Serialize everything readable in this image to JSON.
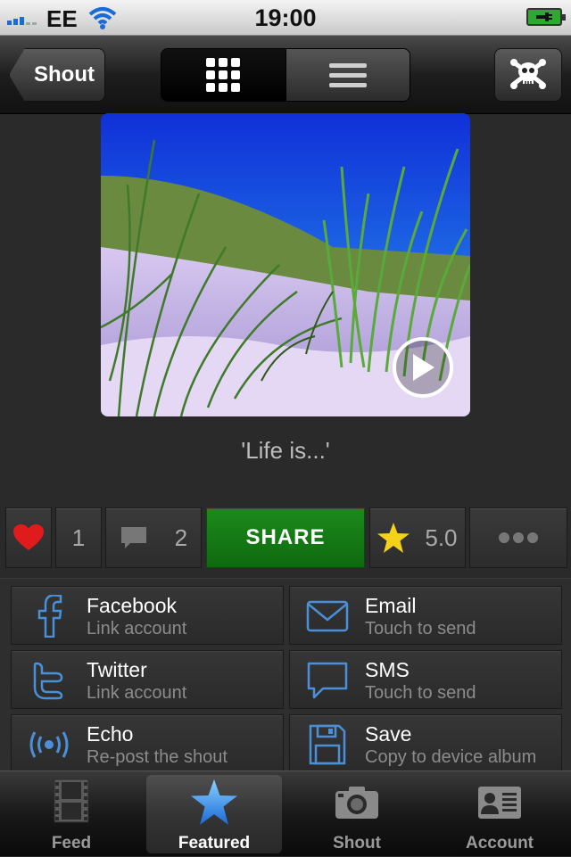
{
  "status": {
    "carrier": "EE",
    "time": "19:00"
  },
  "nav": {
    "back_label": "Shout",
    "segments": [
      "grid-view",
      "list-view"
    ],
    "active_segment": "grid-view"
  },
  "post": {
    "caption": "'Life is...'"
  },
  "actions": {
    "like_count": "1",
    "comment_count": "2",
    "share_label": "SHARE",
    "rating": "5.0"
  },
  "share_options": [
    {
      "title": "Facebook",
      "subtitle": "Link account",
      "icon": "facebook-icon"
    },
    {
      "title": "Email",
      "subtitle": "Touch to send",
      "icon": "envelope-icon"
    },
    {
      "title": "Twitter",
      "subtitle": "Link account",
      "icon": "twitter-icon"
    },
    {
      "title": "SMS",
      "subtitle": "Touch to send",
      "icon": "speech-bubble-icon"
    },
    {
      "title": "Echo",
      "subtitle": "Re-post the shout",
      "icon": "broadcast-icon"
    },
    {
      "title": "Save",
      "subtitle": "Copy to device album",
      "icon": "floppy-disk-icon"
    }
  ],
  "tabs": [
    {
      "label": "Feed",
      "icon": "film-strip-icon"
    },
    {
      "label": "Featured",
      "icon": "star-icon",
      "active": true
    },
    {
      "label": "Shout",
      "icon": "camera-icon"
    },
    {
      "label": "Account",
      "icon": "contact-card-icon"
    }
  ],
  "colors": {
    "accent_green": "#1c8a1c",
    "icon_blue": "#4a90d9",
    "heart_red": "#e01b1b",
    "star_yellow": "#f5d21a"
  }
}
